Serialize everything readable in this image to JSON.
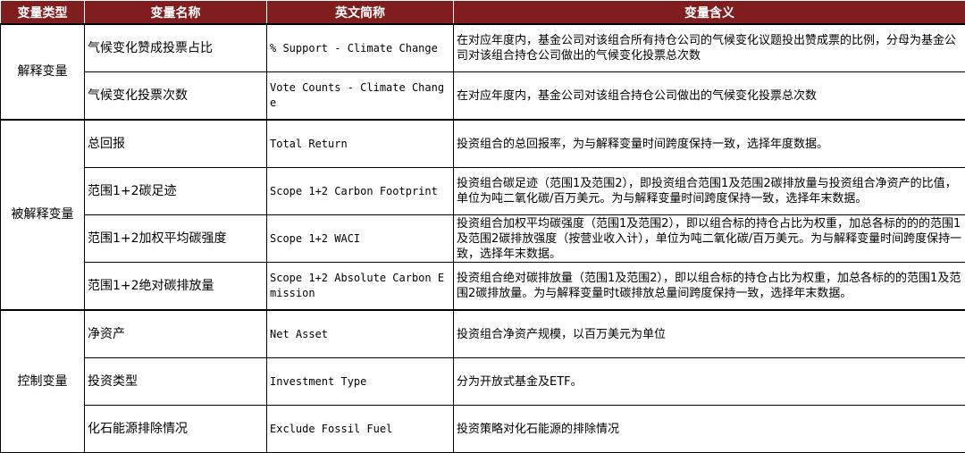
{
  "header": {
    "col1": "变量类型",
    "col2": "变量名称",
    "col3": "英文简称",
    "col4": "变量含义"
  },
  "groups": [
    {
      "type": "解释变量",
      "rows": [
        {
          "cn": "气候变化赞成投票占比",
          "en": "% Support - Climate Change",
          "meaning": "在对应年度内，基金公司对该组合所有持仓公司的气候变化议题投出赞成票的比例，分母为基金公司对该组合持仓公司做出的气候变化投票总次数"
        },
        {
          "cn": "气候变化投票次数",
          "en": "Vote Counts - Climate Change",
          "meaning": "在对应年度内，基金公司对该组合持仓公司做出的气候变化投票总次数"
        }
      ]
    },
    {
      "type": "被解释变量",
      "rows": [
        {
          "cn": "总回报",
          "en": "Total Return",
          "meaning": "投资组合的总回报率，为与解释变量时间跨度保持一致，选择年度数据。"
        },
        {
          "cn": "范围1+2碳足迹",
          "en": "Scope 1+2 Carbon Footprint",
          "meaning": "投资组合碳足迹（范围1及范围2），即投资组合范围1及范围2碳排放量与投资组合净资产的比值，单位为吨二氧化碳/百万美元。为与解释变量时间跨度保持一致，选择年末数据。"
        },
        {
          "cn": "范围1+2加权平均碳强度",
          "en": "Scope 1+2 WACI",
          "meaning": "投资组合加权平均碳强度（范围1及范围2），即以组合标的持仓占比为权重，加总各标的的的范围1及范围2碳排放强度（按营业收入计），单位为吨二氧化碳/百万美元。为与解释变量时间跨度保持一致，选择年末数据。"
        },
        {
          "cn": "范围1+2绝对碳排放量",
          "en": "Scope 1+2 Absolute Carbon Emission",
          "meaning": "投资组合绝对碳排放量（范围1及范围2），即以组合标的持仓占比为权重，加总各标的的范围1及范围2碳排放量。为与解释变量时t碳排放总量间跨度保持一致，选择年末数据。"
        }
      ]
    },
    {
      "type": "控制变量",
      "rows": [
        {
          "cn": "净资产",
          "en": "Net Asset",
          "meaning": "投资组合净资产规模，以百万美元为单位"
        },
        {
          "cn": "投资类型",
          "en": "Investment Type",
          "meaning": "分为开放式基金及ETF。"
        },
        {
          "cn": "化石能源排除情况",
          "en": "Exclude Fossil Fuel",
          "meaning": "投资策略对化石能源的排除情况"
        }
      ]
    }
  ]
}
